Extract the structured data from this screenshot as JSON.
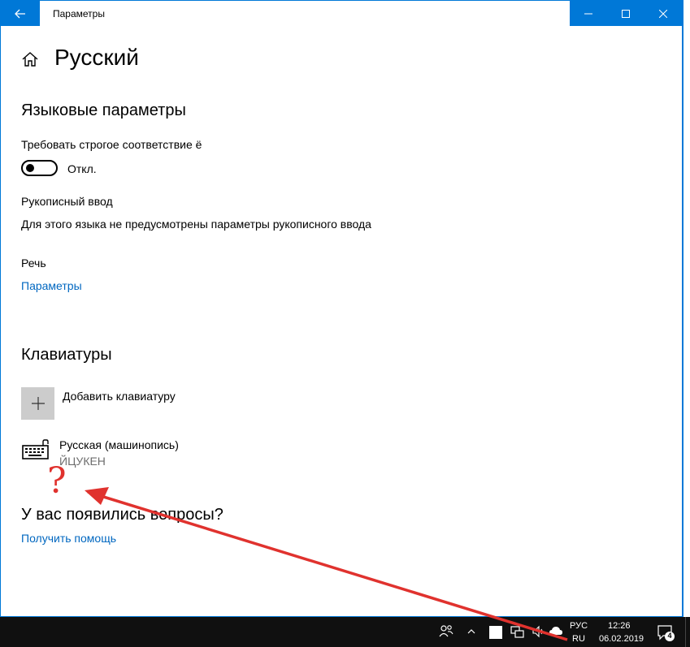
{
  "window": {
    "title": "Параметры",
    "controls": [
      "minimize",
      "maximize",
      "close"
    ]
  },
  "page": {
    "title": "Русский"
  },
  "language_options": {
    "section_title": "Языковые параметры",
    "strict_yo_label": "Требовать строгое соответствие ё",
    "strict_yo_state": "Откл.",
    "strict_yo_on": false,
    "handwriting_label": "Рукописный ввод",
    "handwriting_note": "Для этого языка не предусмотрены параметры рукописного ввода",
    "speech_label": "Речь",
    "speech_link": "Параметры"
  },
  "keyboards": {
    "section_title": "Клавиатуры",
    "add_label": "Добавить клавиатуру",
    "items": [
      {
        "name": "Русская (машинопись)",
        "layout": "ЙЦУКЕН"
      }
    ]
  },
  "help": {
    "title": "У вас появились вопросы?",
    "link": "Получить помощь"
  },
  "annotation": {
    "symbol": "?",
    "color": "#e0322e"
  },
  "taskbar": {
    "lang_top": "РУС",
    "lang_bottom": "RU",
    "time": "12:26",
    "date": "06.02.2019",
    "notification_count": "4"
  },
  "colors": {
    "accent": "#0078d7",
    "link": "#0067c0",
    "annotation": "#e0322e"
  }
}
